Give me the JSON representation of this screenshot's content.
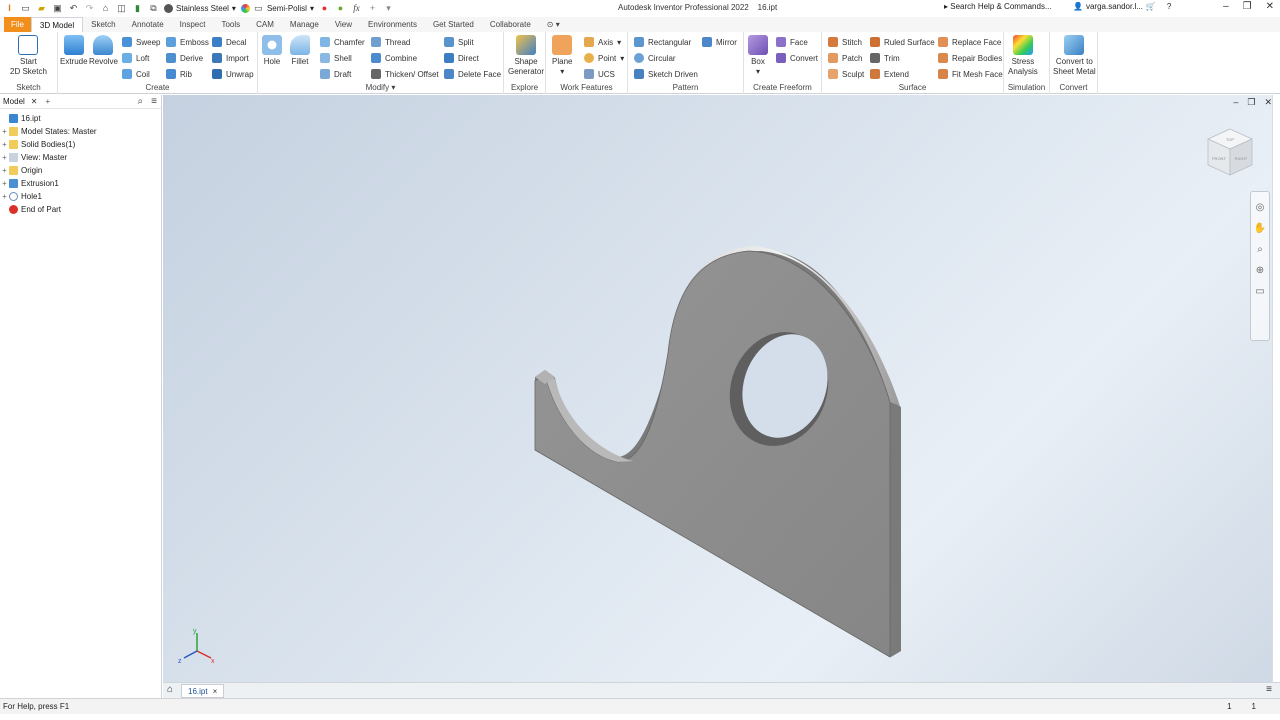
{
  "title_bar": {
    "material": "Stainless Steel",
    "appearance": "Semi-Polisl",
    "fx_symbol": "fx",
    "app_title": "Autodesk Inventor Professional 2022",
    "file_name": "16.ipt",
    "search_placeholder": "Search Help & Commands...",
    "user_name": "varga.sandor.l..."
  },
  "tabs": [
    {
      "label": "File"
    },
    {
      "label": "3D Model"
    },
    {
      "label": "Sketch"
    },
    {
      "label": "Annotate"
    },
    {
      "label": "Inspect"
    },
    {
      "label": "Tools"
    },
    {
      "label": "CAM"
    },
    {
      "label": "Manage"
    },
    {
      "label": "View"
    },
    {
      "label": "Environments"
    },
    {
      "label": "Get Started"
    },
    {
      "label": "Collaborate"
    }
  ],
  "ribbon": {
    "sketch": {
      "label": "Sketch",
      "start": "Start",
      "start2": "2D Sketch"
    },
    "create": {
      "label": "Create",
      "extrude": "Extrude",
      "revolve": "Revolve",
      "sweep": "Sweep",
      "emboss": "Emboss",
      "decal": "Decal",
      "loft": "Loft",
      "derive": "Derive",
      "import": "Import",
      "coil": "Coil",
      "rib": "Rib",
      "unwrap": "Unwrap"
    },
    "modify": {
      "label": "Modify",
      "hole": "Hole",
      "fillet": "Fillet",
      "chamfer": "Chamfer",
      "thread": "Thread",
      "split": "Split",
      "shell": "Shell",
      "combine": "Combine",
      "direct": "Direct",
      "draft": "Draft",
      "thicken": "Thicken/ Offset",
      "delete_face": "Delete Face"
    },
    "explore": {
      "label": "Explore",
      "shape_gen": "Shape",
      "shape_gen2": "Generator"
    },
    "work_features": {
      "label": "Work Features",
      "plane": "Plane",
      "axis": "Axis",
      "point": "Point",
      "ucs": "UCS"
    },
    "pattern": {
      "label": "Pattern",
      "rectangular": "Rectangular",
      "mirror": "Mirror",
      "circular": "Circular",
      "sketch_driven": "Sketch Driven"
    },
    "create_freeform": {
      "label": "Create Freeform",
      "box": "Box",
      "face": "Face",
      "convert": "Convert"
    },
    "surface": {
      "label": "Surface",
      "stitch": "Stitch",
      "ruled_surface": "Ruled Surface",
      "replace_face": "Replace Face",
      "patch": "Patch",
      "trim": "Trim",
      "repair_bodies": "Repair Bodies",
      "sculpt": "Sculpt",
      "extend": "Extend",
      "fit_mesh_face": "Fit Mesh Face"
    },
    "simulation": {
      "label": "Simulation",
      "stress": "Stress",
      "stress2": "Analysis"
    },
    "convert": {
      "label": "Convert",
      "sheet": "Convert to",
      "sheet2": "Sheet Metal"
    }
  },
  "browser": {
    "tab": "Model",
    "tree": [
      {
        "label": "16.ipt"
      },
      {
        "label": "Model States: Master"
      },
      {
        "label": "Solid Bodies(1)"
      },
      {
        "label": "View: Master"
      },
      {
        "label": "Origin"
      },
      {
        "label": "Extrusion1"
      },
      {
        "label": "Hole1"
      },
      {
        "label": "End of Part"
      }
    ]
  },
  "viewcube": {
    "front": "FRONT",
    "right": "RIGHT",
    "top": "TOP"
  },
  "triad": {
    "x": "x",
    "y": "y",
    "z": "z"
  },
  "doc_tab": {
    "label": "16.ipt",
    "close": "×"
  },
  "status": {
    "help": "For Help, press F1",
    "count1": "1",
    "count2": "1"
  },
  "colors": {
    "accent": "#f28e1c",
    "part_face": "#8f8f8f",
    "part_edge": "#6a6a6a"
  }
}
